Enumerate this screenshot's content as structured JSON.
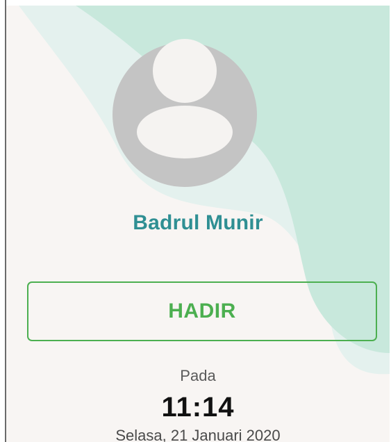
{
  "colors": {
    "background": "#f8f5f3",
    "wave_light": "#e4f1ee",
    "wave_mint": "#c8e8dc",
    "avatar_gray": "#c4c4c4",
    "name_teal": "#2f8f93",
    "accent_green": "#4caf50",
    "time_text": "#111111"
  },
  "profile": {
    "avatar_icon": "person-placeholder-icon",
    "name": "Badrul Munir"
  },
  "attendance": {
    "status_label": "HADIR",
    "time_prefix": "Pada",
    "time": "11:14",
    "date": "Selasa, 21 Januari 2020"
  }
}
